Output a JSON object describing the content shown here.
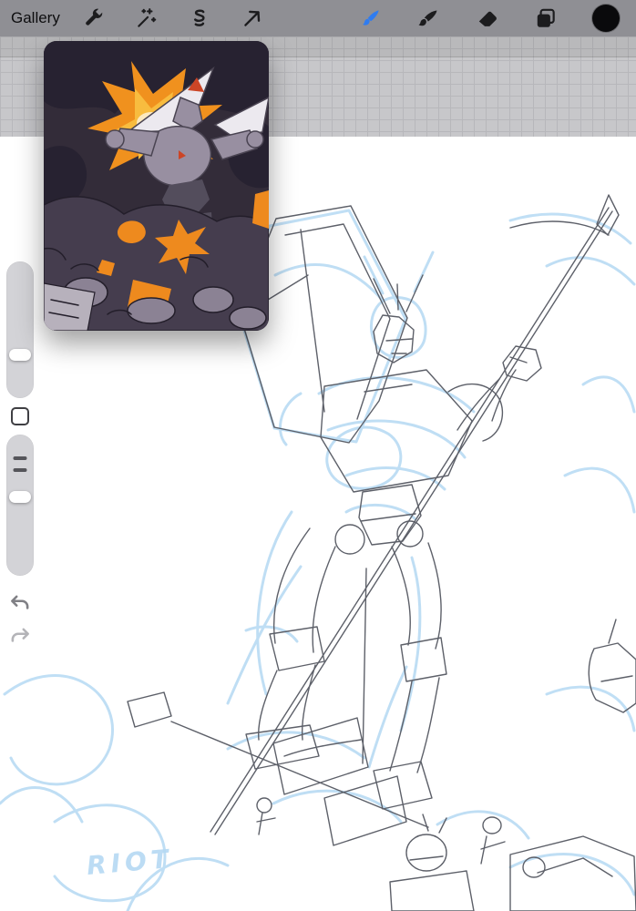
{
  "topbar": {
    "gallery_label": "Gallery",
    "tools_left": [
      {
        "id": "actions",
        "icon": "wrench-icon"
      },
      {
        "id": "adjustments",
        "icon": "magic-wand-icon"
      },
      {
        "id": "selection",
        "icon": "selection-s-icon"
      },
      {
        "id": "transform",
        "icon": "transform-arrow-icon"
      }
    ],
    "tools_right": [
      {
        "id": "paint",
        "icon": "paintbrush-icon",
        "active": true
      },
      {
        "id": "smudge",
        "icon": "smudge-icon",
        "active": false
      },
      {
        "id": "erase",
        "icon": "eraser-icon",
        "active": false
      },
      {
        "id": "layers",
        "icon": "layers-icon",
        "active": false
      },
      {
        "id": "color",
        "icon": "color-swatch",
        "swatch_color": "#0a0a0c",
        "active": false
      }
    ],
    "colors": {
      "bar_bg": "#8f8f94",
      "icon": "#1c1c1e",
      "active_accent": "#2f7cf0"
    }
  },
  "sidebar": {
    "size_slider": {
      "id": "brush-size-slider"
    },
    "modify_button": {
      "id": "modify-button"
    },
    "opacity_slider": {
      "id": "brush-opacity-slider"
    },
    "undo": {
      "id": "undo",
      "icon": "undo-arrow-icon"
    },
    "redo": {
      "id": "redo",
      "icon": "redo-arrow-icon"
    }
  },
  "reference_window": {
    "type": "reference-image-thumbnail",
    "colors": {
      "bg": "#332c39",
      "dark": "#272231",
      "flame": "#f0911e",
      "flame_light": "#f8bc3f",
      "flame_core": "#fce9c0",
      "blade": "#ece9ef",
      "armor": "#988fa1",
      "armor_dark": "#534d5c",
      "accent_red": "#cc4526",
      "rock": "#453d4e",
      "rubble": "#8b8294",
      "lava": "#ee8a1e",
      "outline": "#231e2a",
      "corner_light": "#b7b1bc"
    }
  },
  "canvas": {
    "signature_text": "RIOT",
    "colors": {
      "sketch_blue": "#b5d9f3",
      "graphite": "#5d6069",
      "grid_bg": "#c7c7ca",
      "grid_line": "#b7b7bb",
      "paper": "#ffffff"
    }
  }
}
